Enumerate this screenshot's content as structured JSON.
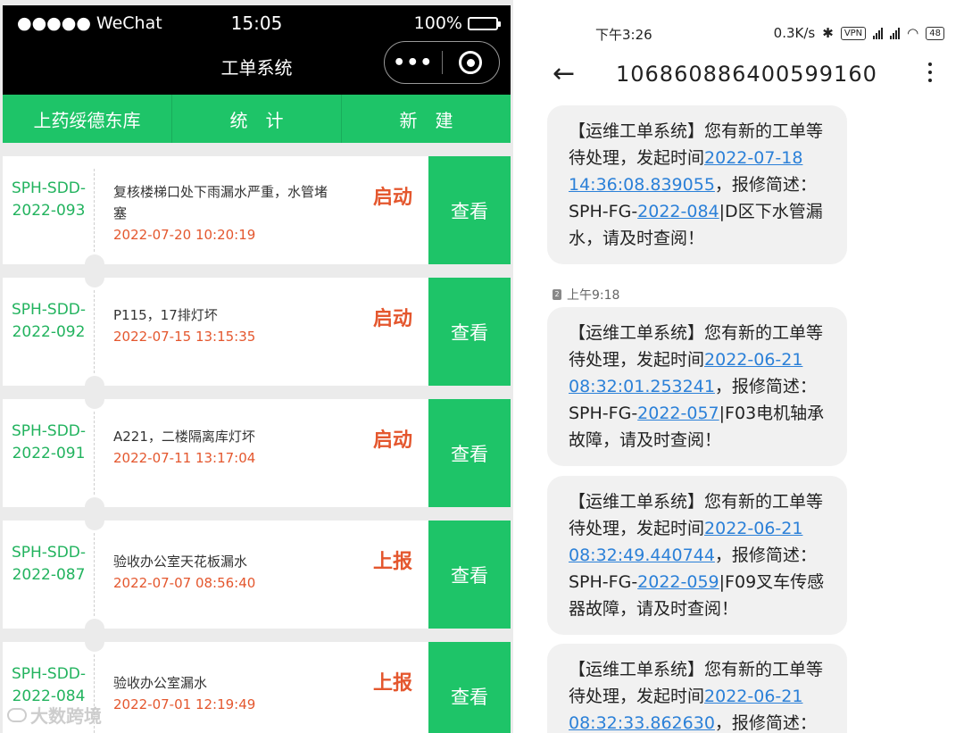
{
  "wechat": {
    "carrier": "●●●●● WeChat",
    "time": "15:05",
    "battery": "100%",
    "title": "工单系统",
    "capsule_more": "•••"
  },
  "tabs": [
    "上药绥德东库",
    "统　计",
    "新　建"
  ],
  "orders": [
    {
      "code1": "SPH-SDD-",
      "code2": "2022-093",
      "desc": "复核楼梯口处下雨漏水严重，水管堵塞",
      "datetime": "2022-07-20 10:20:19",
      "status": "启动",
      "action": "查看"
    },
    {
      "code1": "SPH-SDD-",
      "code2": "2022-092",
      "desc": "P115，17排灯坏",
      "datetime": "2022-07-15 13:15:35",
      "status": "启动",
      "action": "查看"
    },
    {
      "code1": "SPH-SDD-",
      "code2": "2022-091",
      "desc": "A221，二楼隔离库灯坏",
      "datetime": "2022-07-11 13:17:04",
      "status": "启动",
      "action": "查看"
    },
    {
      "code1": "SPH-SDD-",
      "code2": "2022-087",
      "desc": "验收办公室天花板漏水",
      "datetime": "2022-07-07 08:56:40",
      "status": "上报",
      "action": "查看"
    },
    {
      "code1": "SPH-SDD-",
      "code2": "2022-084",
      "desc": "验收办公室漏水",
      "datetime": "2022-07-01 12:19:49",
      "status": "上报",
      "action": "查看"
    }
  ],
  "watermark": "大数跨境",
  "sms": {
    "status_time": "下午3:26",
    "net_speed": "0.3K/s",
    "vpn": "VPN",
    "battery": "48",
    "sender": "106860886400599160",
    "received_time": "上午9:18",
    "sim_label": "2",
    "messages": [
      {
        "prefix": "【运维工单系统】您有新的工单等待处理，发起时间",
        "date": "2022-07-18",
        "time": "14:36:08.839055",
        "mid": "，报修简述：SPH-FG-",
        "num": "2022-084",
        "suffix": "|D区下水管漏水，请及时查阅！"
      },
      {
        "prefix": "【运维工单系统】您有新的工单等待处理，发起时间",
        "date": "2022-06-21",
        "time": "08:32:01.253241",
        "mid": "，报修简述：SPH-FG-",
        "num": "2022-057",
        "suffix": "|F03电机轴承故障，请及时查阅！"
      },
      {
        "prefix": "【运维工单系统】您有新的工单等待处理，发起时间",
        "date": "2022-06-21",
        "time": "08:32:49.440744",
        "mid": "，报修简述：SPH-FG-",
        "num": "2022-059",
        "suffix": "|F09叉车传感器故障，请及时查阅！"
      },
      {
        "prefix": "【运维工单系统】您有新的工单等待处理，发起时间",
        "date": "2022-06-21",
        "time": "08:32:33.862630",
        "mid": "，报修简述：",
        "num": "",
        "suffix": ""
      }
    ]
  },
  "colors": {
    "green": "#1ec468",
    "status_red": "#e4572e",
    "link_blue": "#2b80d8"
  }
}
